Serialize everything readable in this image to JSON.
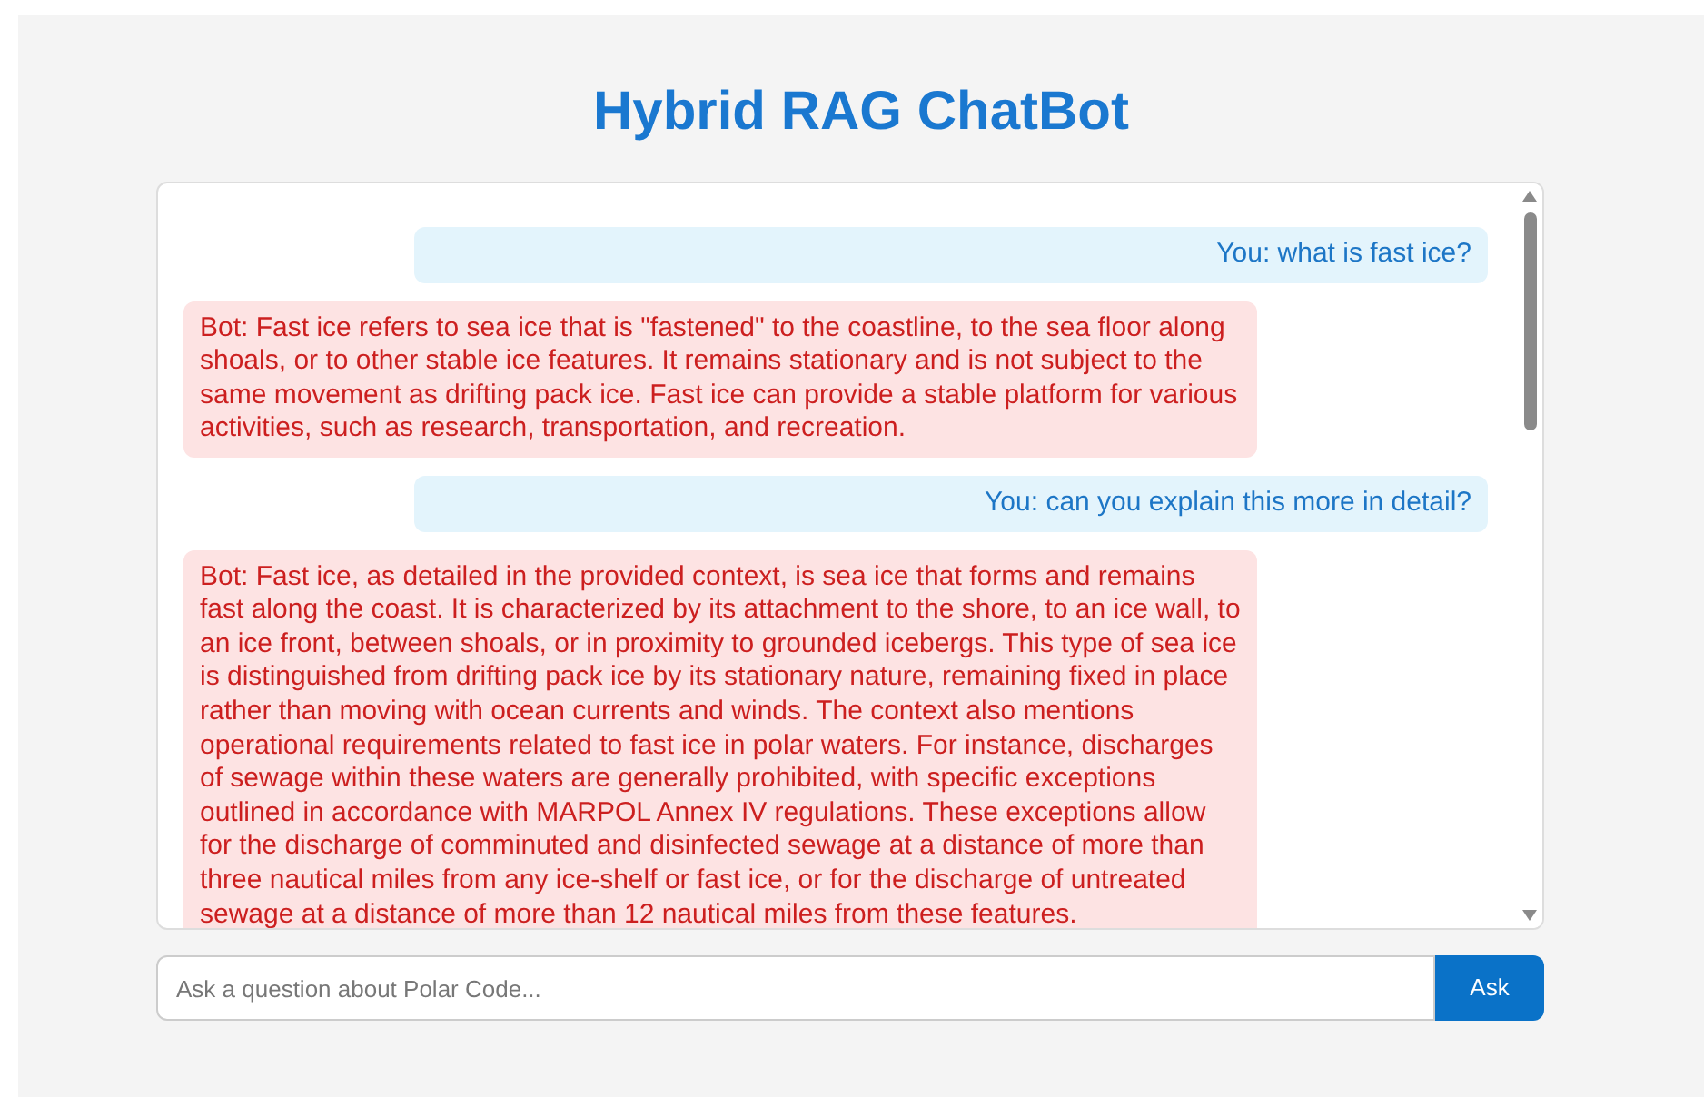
{
  "title": "Hybrid RAG ChatBot",
  "messages": [
    {
      "kind": "user",
      "text": "You: what is fast ice?"
    },
    {
      "kind": "bot",
      "text": "Bot: Fast ice refers to sea ice that is \"fastened\" to the coastline, to the sea floor along shoals, or to other stable ice features. It remains stationary and is not subject to the same movement as drifting pack ice. Fast ice can provide a stable platform for various activities, such as research, transportation, and recreation."
    },
    {
      "kind": "user",
      "text": "You: can you explain this more in detail?"
    },
    {
      "kind": "bot",
      "text": "Bot: Fast ice, as detailed in the provided context, is sea ice that forms and remains fast along the coast. It is characterized by its attachment to the shore, to an ice wall, to an ice front, between shoals, or in proximity to grounded icebergs. This type of sea ice is distinguished from drifting pack ice by its stationary nature, remaining fixed in place rather than moving with ocean currents and winds. The context also mentions operational requirements related to fast ice in polar waters. For instance, discharges of sewage within these waters are generally prohibited, with specific exceptions outlined in accordance with MARPOL Annex IV regulations. These exceptions allow for the discharge of comminuted and disinfected sewage at a distance of more than three nautical miles from any ice-shelf or fast ice, or for the discharge of untreated sewage at a distance of more than 12 nautical miles from these features."
    }
  ],
  "input": {
    "placeholder": "Ask a question about Polar Code..."
  },
  "button": "Ask"
}
